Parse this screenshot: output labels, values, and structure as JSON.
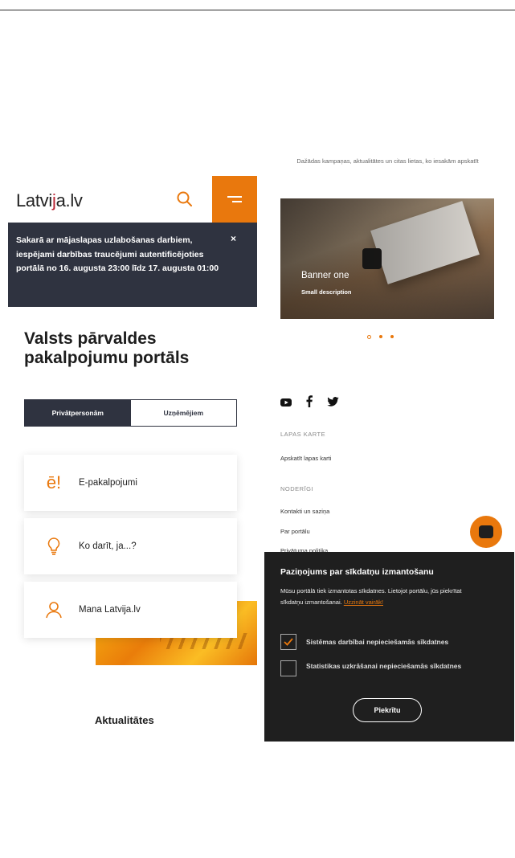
{
  "header": {
    "logo_prefix": "Latvi",
    "logo_mark": "j",
    "logo_suffix": "a.lv",
    "search_icon": "search-icon",
    "menu_icon": "menu-icon",
    "accent": "#e9780d"
  },
  "notice": {
    "text": "Sakarā ar mājaslapas uzlabošanas darbiem, iespējami darbības traucējumi autentificējoties portālā no 16. augusta 23:00 līdz 17. augusta 01:00",
    "close": "×"
  },
  "portal_title": "Valsts pārvaldes pakalpojumu portāls",
  "audience_tabs": [
    {
      "label": "Privātpersonām",
      "active": true
    },
    {
      "label": "Uzņēmējiem",
      "active": false
    }
  ],
  "cards": [
    {
      "label": "E-pakalpojumi",
      "icon": "e-services-icon",
      "glyph": "ē!"
    },
    {
      "label": "Ko darīt, ja...?",
      "icon": "lightbulb-icon"
    },
    {
      "label": "Mana Latvija.lv",
      "icon": "user-icon"
    }
  ],
  "news_heading": "Aktualitātes",
  "banner": {
    "intro": "Dažādas kampaņas, aktualitātes un citas lietas, ko iesakām apskatīt",
    "title": "Banner one",
    "description": "Small description",
    "dots": 3,
    "active_dot": 0
  },
  "social": [
    "youtube-icon",
    "facebook-icon",
    "twitter-icon"
  ],
  "footer": {
    "sitemap_heading": "LAPAS KARTE",
    "sitemap_link": "Apskatīt lapas karti",
    "useful_heading": "NODERĪGI",
    "useful_links": [
      "Kontakti un saziņa",
      "Par portālu",
      "Privātuma politika"
    ]
  },
  "chat_icon": "chat-icon",
  "cookie": {
    "title": "Paziņojums par sīkdatņu izmantošanu",
    "body": "Mūsu portālā tiek izmantotas sīkdatnes. Lietojot portālu, jūs piekrītat sīkdatņu izmantošanai.",
    "more": "Uzzināt vairāk!",
    "options": [
      {
        "label": "Sistēmas darbībai nepieciešamās sīkdatnes",
        "checked": true
      },
      {
        "label": "Statistikas uzkrāšanai nepieciešamās sīkdatnes",
        "checked": false
      }
    ],
    "accept": "Piekrītu"
  }
}
